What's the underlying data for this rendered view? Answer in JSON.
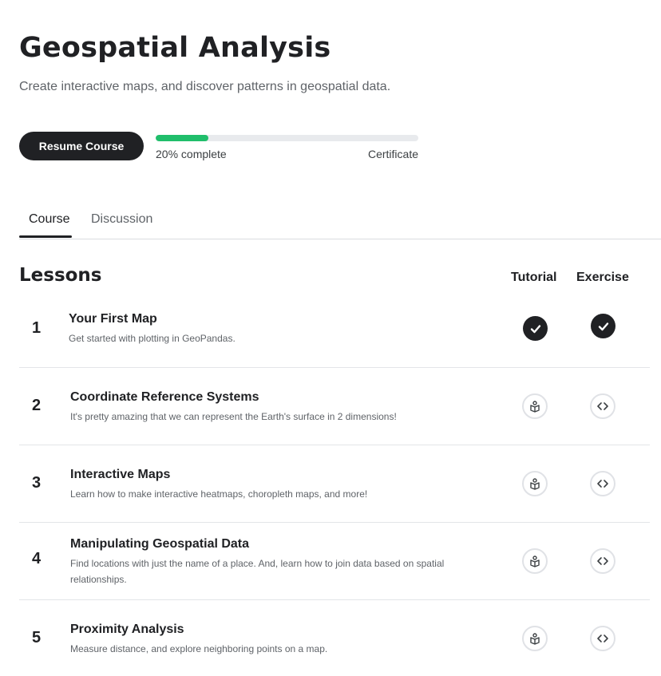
{
  "course": {
    "title": "Geospatial Analysis",
    "subtitle": "Create interactive maps, and discover patterns in geospatial data."
  },
  "actions": {
    "resume_label": "Resume Course"
  },
  "progress": {
    "percent": 20,
    "label": "20% complete",
    "certificate_label": "Certificate",
    "fill_color": "#20be6b"
  },
  "tabs": [
    {
      "label": "Course",
      "active": true
    },
    {
      "label": "Discussion",
      "active": false
    }
  ],
  "lessons_section": {
    "heading": "Lessons",
    "col_tutorial": "Tutorial",
    "col_exercise": "Exercise"
  },
  "lessons": [
    {
      "number": "1",
      "title": "Your First Map",
      "description": "Get started with plotting in GeoPandas.",
      "tutorial_icon": "check-icon",
      "exercise_icon": "check-icon"
    },
    {
      "number": "2",
      "title": "Coordinate Reference Systems",
      "description": "It's pretty amazing that we can represent the Earth's surface in 2 dimensions!",
      "tutorial_icon": "notebook-icon",
      "exercise_icon": "code-icon"
    },
    {
      "number": "3",
      "title": "Interactive Maps",
      "description": "Learn how to make interactive heatmaps, choropleth maps, and more!",
      "tutorial_icon": "notebook-icon",
      "exercise_icon": "code-icon"
    },
    {
      "number": "4",
      "title": "Manipulating Geospatial Data",
      "description": "Find locations with just the name of a place. And, learn how to join data based on spatial relationships.",
      "tutorial_icon": "notebook-icon",
      "exercise_icon": "code-icon"
    },
    {
      "number": "5",
      "title": "Proximity Analysis",
      "description": "Measure distance, and explore neighboring points on a map.",
      "tutorial_icon": "notebook-icon",
      "exercise_icon": "code-icon"
    }
  ]
}
